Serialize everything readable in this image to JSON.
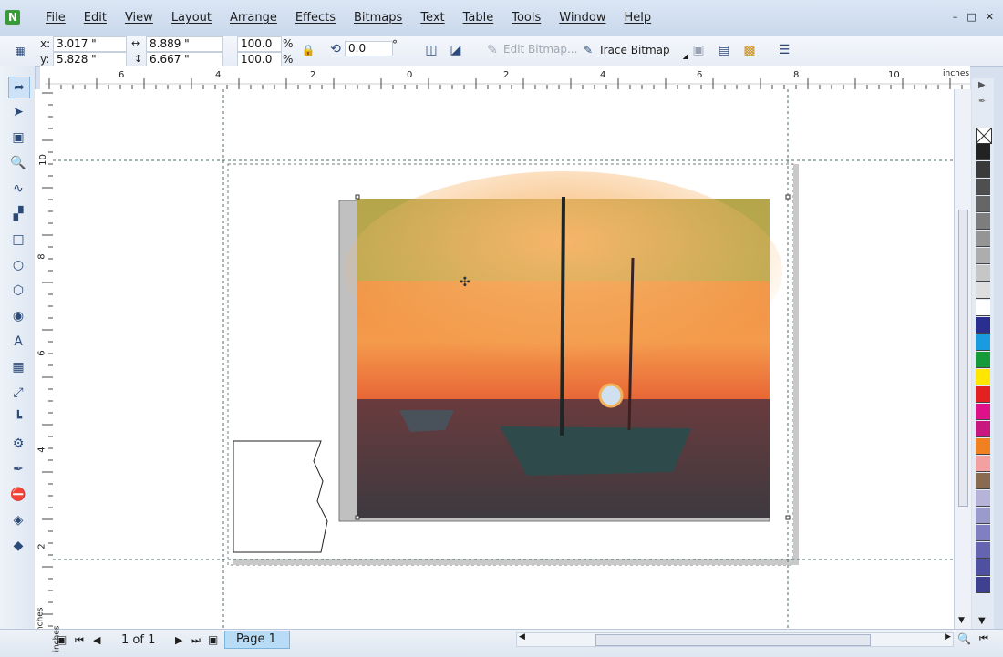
{
  "menu": {
    "items": [
      "File",
      "Edit",
      "View",
      "Layout",
      "Arrange",
      "Effects",
      "Bitmaps",
      "Text",
      "Table",
      "Tools",
      "Window",
      "Help"
    ]
  },
  "propertybar": {
    "x_label": "x:",
    "x_value": "3.017 \"",
    "y_label": "y:",
    "y_value": "5.828 \"",
    "width_value": "8.889 \"",
    "height_value": "6.667 \"",
    "scale_x": "100.0",
    "scale_y": "100.0",
    "percent": "%",
    "rotation": "0.0",
    "degree": "°",
    "edit_bitmap": "Edit Bitmap...",
    "trace_bitmap": "Trace Bitmap"
  },
  "ruler": {
    "unit": "inches",
    "h_ticks": [
      "6",
      "4",
      "2",
      "0",
      "2",
      "4",
      "6",
      "8",
      "10"
    ],
    "v_ticks": [
      "10",
      "8",
      "6",
      "4",
      "2"
    ],
    "v_unit": "inches"
  },
  "status": {
    "page_count": "1 of 1",
    "page_tab": "Page 1"
  },
  "palette": {
    "colors": [
      "#222222",
      "#3a3a3a",
      "#4f4f4f",
      "#666666",
      "#7d7d7d",
      "#959595",
      "#adadad",
      "#c6c6c6",
      "#dedede",
      "#ffffff",
      "#2a2f8f",
      "#1a9be0",
      "#179a3a",
      "#ffe600",
      "#e52020",
      "#e0108a",
      "#c81880",
      "#f08020",
      "#f2a0a0",
      "#8a6a50",
      "#b6b2d8",
      "#9a9acd",
      "#7f7fc2",
      "#6464b0",
      "#5050a0",
      "#404090"
    ]
  }
}
